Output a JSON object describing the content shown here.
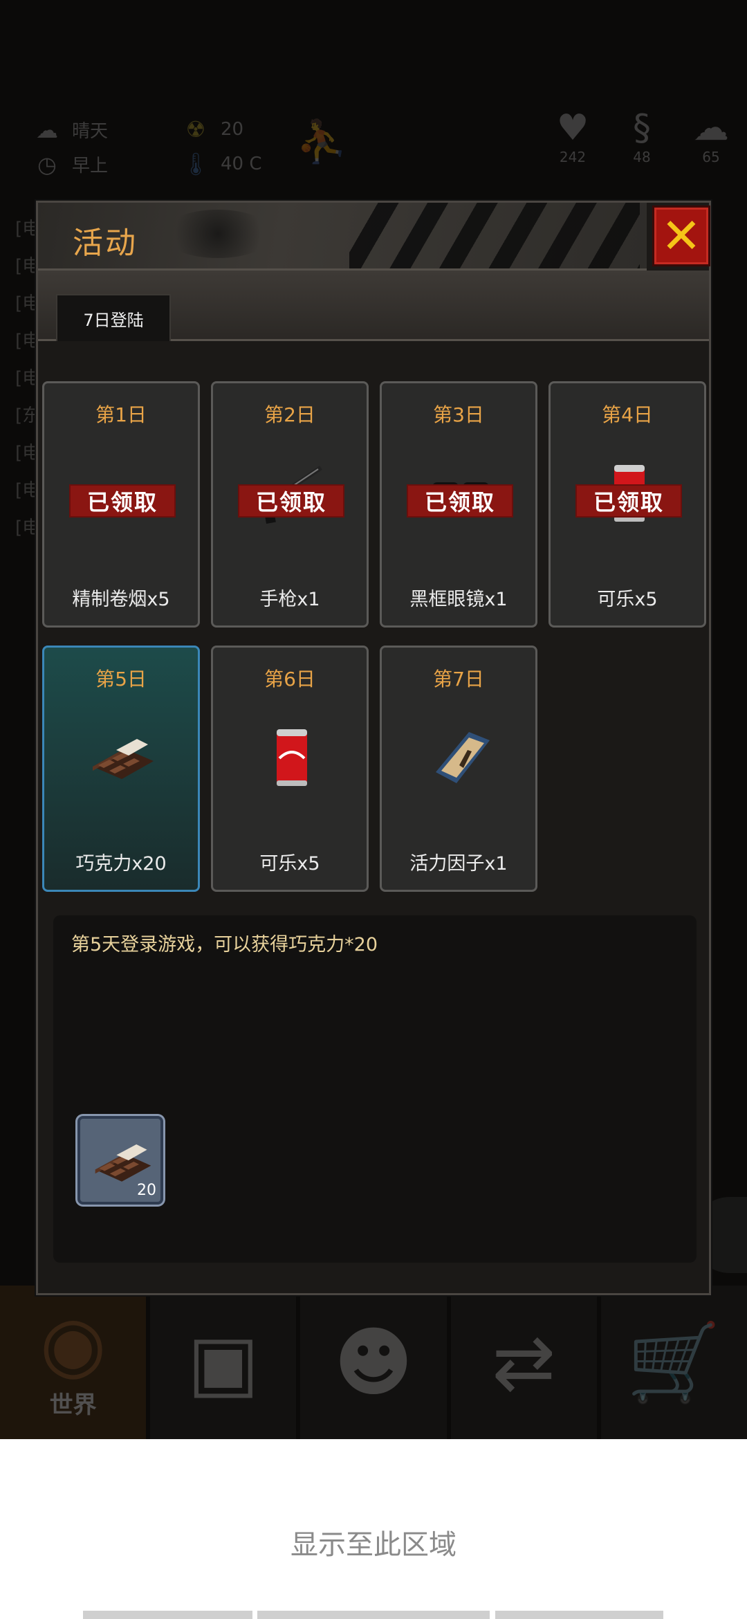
{
  "hud": {
    "weather": "晴天",
    "time_of_day": "早上",
    "radiation": "20",
    "temperature": "40 C",
    "health": "242",
    "hunger": "48",
    "sanity": "65"
  },
  "background_log_prefixes": [
    "[电",
    "[电",
    "[电",
    "[电",
    "[电",
    "[东",
    "[电",
    "[电",
    "[电"
  ],
  "dialog": {
    "title": "活动",
    "close_symbol": "✕",
    "tab": "7日登陆",
    "claimed_label": "已领取",
    "days": [
      {
        "day": "第1日",
        "name": "精制卷烟x5",
        "claimed": true,
        "icon": "cigarette-icon"
      },
      {
        "day": "第2日",
        "name": "手枪x1",
        "claimed": true,
        "icon": "pistol-icon"
      },
      {
        "day": "第3日",
        "name": "黑框眼镜x1",
        "claimed": true,
        "icon": "glasses-icon"
      },
      {
        "day": "第4日",
        "name": "可乐x5",
        "claimed": true,
        "icon": "cola-can-icon"
      },
      {
        "day": "第5日",
        "name": "巧克力x20",
        "claimed": false,
        "selected": true,
        "icon": "chocolate-icon"
      },
      {
        "day": "第6日",
        "name": "可乐x5",
        "claimed": false,
        "icon": "cola-can-icon"
      },
      {
        "day": "第7日",
        "name": "活力因子x1",
        "claimed": false,
        "icon": "vitality-box-icon"
      }
    ],
    "description": "第5天登录游戏，可以获得巧克力*20",
    "reward_count": "20"
  },
  "bottom_nav": {
    "tabs": [
      {
        "label": "世界",
        "icon": "globe-icon"
      },
      {
        "label": "",
        "icon": "briefcase-icon"
      },
      {
        "label": "",
        "icon": "head-gear-icon"
      },
      {
        "label": "",
        "icon": "exchange-icon"
      },
      {
        "label": "",
        "icon": "cart-icon"
      }
    ]
  },
  "footer": {
    "text": "显示至此区域"
  }
}
